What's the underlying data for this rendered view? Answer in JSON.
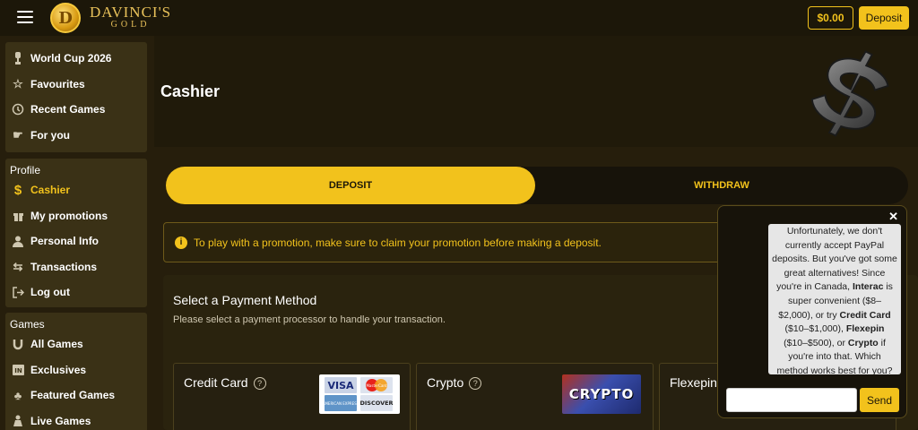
{
  "brand": {
    "name_line1": "DAVINCI'S",
    "name_line2": "GOLD",
    "coin_glyph": "D"
  },
  "topbar": {
    "balance": "$0.00",
    "deposit_label": "Deposit"
  },
  "sidebar": {
    "main_items": [
      {
        "label": "World Cup 2026",
        "icon": "trophy-icon"
      },
      {
        "label": "Favourites",
        "icon": "star-icon"
      },
      {
        "label": "Recent Games",
        "icon": "history-icon"
      },
      {
        "label": "For you",
        "icon": "pointing-hand-icon"
      }
    ],
    "profile_heading": "Profile",
    "profile_items": [
      {
        "label": "Cashier",
        "icon": "dollar-icon",
        "active": true
      },
      {
        "label": "My promotions",
        "icon": "gift-icon"
      },
      {
        "label": "Personal Info",
        "icon": "user-icon"
      },
      {
        "label": "Transactions",
        "icon": "transfer-icon"
      },
      {
        "label": "Log out",
        "icon": "logout-icon"
      }
    ],
    "games_heading": "Games",
    "games_items": [
      {
        "label": "All Games",
        "icon": "horseshoe-icon"
      },
      {
        "label": "Exclusives",
        "icon": "exclusive-badge-icon"
      },
      {
        "label": "Featured Games",
        "icon": "clover-icon"
      },
      {
        "label": "Live Games",
        "icon": "live-person-icon"
      }
    ]
  },
  "main": {
    "title": "Cashier",
    "tabs": {
      "deposit": "DEPOSIT",
      "withdraw": "WITHDRAW"
    },
    "notice": "To play with a promotion, make sure to claim your promotion before making a deposit.",
    "payment": {
      "title": "Select a Payment Method",
      "subtitle": "Please select a payment processor to handle your transaction.",
      "methods": [
        {
          "name": "Credit Card"
        },
        {
          "name": "Crypto",
          "logo_text": "CRYPTO"
        },
        {
          "name": "Flexepin"
        }
      ],
      "card_brands": [
        "VISA",
        "MasterCard",
        "AMERICAN EXPRESS",
        "DISCOVER"
      ]
    }
  },
  "chat": {
    "close_glyph": "✕",
    "message_parts": [
      {
        "text": "Unfortunately, we don't currently accept PayPal deposits. But you've got some great alternatives! Since you're in Canada, ",
        "bold": false
      },
      {
        "text": "Interac",
        "bold": true
      },
      {
        "text": " is super convenient ($8–$2,000), or try ",
        "bold": false
      },
      {
        "text": "Credit Card",
        "bold": true
      },
      {
        "text": " ($10–$1,000), ",
        "bold": false
      },
      {
        "text": "Flexepin",
        "bold": true
      },
      {
        "text": " ($10–$500), or ",
        "bold": false
      },
      {
        "text": "Crypto",
        "bold": true
      },
      {
        "text": " if you're into that. Which method works best for you?",
        "bold": false
      }
    ],
    "input_value": "",
    "send_label": "Send"
  },
  "colors": {
    "accent": "#f2c21c",
    "background": "#261e0c",
    "panel": "#3a3116"
  }
}
